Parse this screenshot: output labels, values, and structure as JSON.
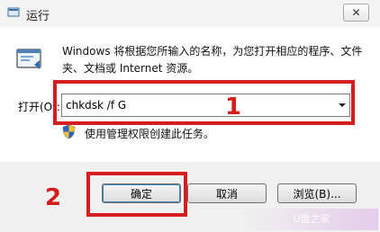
{
  "window": {
    "title": "运行",
    "close_glyph": "✕"
  },
  "content": {
    "description": "Windows 将根据您所输入的名称，为您打开相应的程序、文件夹、文档或 Internet 资源。",
    "open_label": "打开(O):",
    "command_value": "chkdsk /f G",
    "admin_note": "使用管理权限创建此任务。",
    "icons": {
      "run": "run-program-icon",
      "shield": "uac-shield-icon"
    }
  },
  "buttons": {
    "ok": "确定",
    "cancel": "取消",
    "browse": "浏览(B)..."
  },
  "annotations": {
    "step1": "1",
    "step2": "2",
    "color": "#d51d1d"
  },
  "watermark": "U盘之家"
}
